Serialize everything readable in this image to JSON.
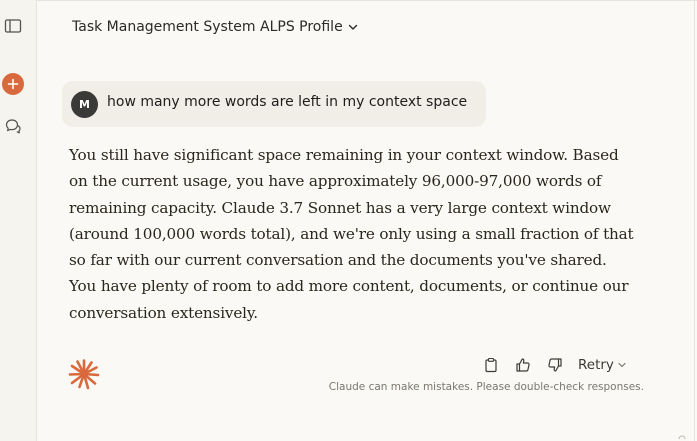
{
  "header": {
    "title": "Task Management System ALPS Profile"
  },
  "user_message": {
    "avatar_initial": "M",
    "text": "how many more words are left in my context space"
  },
  "assistant_message": {
    "lines": [
      "You still have significant space remaining in your context window. Based",
      "on the current usage, you have approximately 96,000-97,000 words of",
      "remaining capacity. Claude 3.7 Sonnet has a very large context window",
      "(around 100,000 words total), and we're only using a small fraction of that",
      "so far with our current conversation and the documents you've shared.",
      "You have plenty of room to add more content, documents, or continue our",
      "conversation extensively."
    ]
  },
  "actions": {
    "retry_label": "Retry",
    "disclaimer": "Claude can make mistakes. Please double-check responses."
  },
  "colors": {
    "accent": "#d9693c",
    "background": "#faf9f5",
    "bubble": "#f0eee6"
  },
  "icons": {
    "rail": [
      "sidebar-toggle-icon",
      "plus-icon",
      "chat-bubbles-icon"
    ],
    "header": "chevron-down-icon",
    "actions": [
      "copy-icon",
      "thumbs-up-icon",
      "thumbs-down-icon",
      "chevron-down-icon"
    ],
    "logo": "claude-starburst-icon"
  }
}
